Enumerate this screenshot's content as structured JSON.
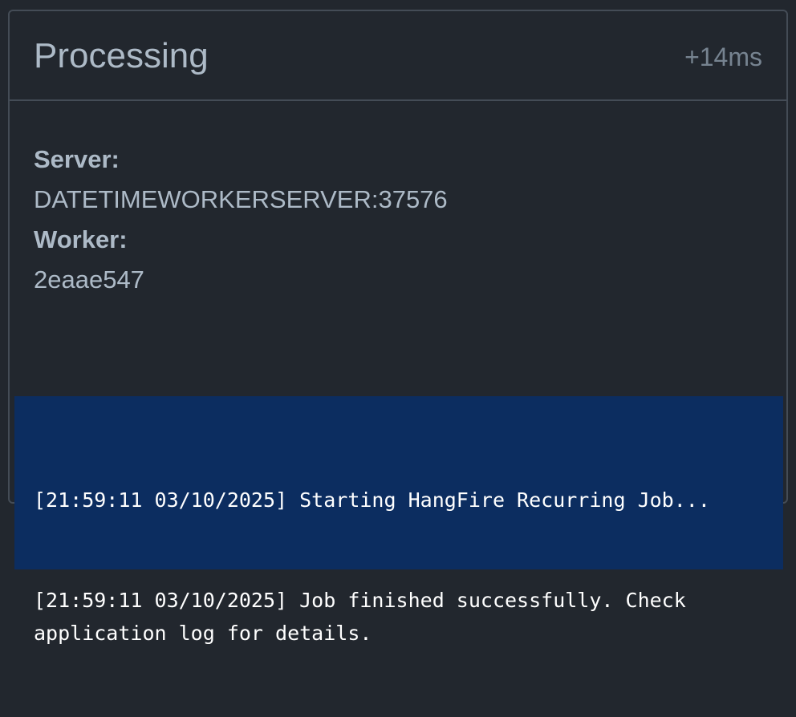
{
  "state": {
    "title": "Processing",
    "duration": "+14ms"
  },
  "details": {
    "server_label": "Server:",
    "server_value": "DATETIMEWORKERSERVER:37576",
    "worker_label": "Worker:",
    "worker_value": "2eaae547"
  },
  "log": {
    "lines": [
      "[21:59:11 03/10/2025] Starting HangFire Recurring Job...",
      "[21:59:11 03/10/2025] Job finished successfully. Check application log for details."
    ]
  },
  "colors": {
    "background": "#22272e",
    "border": "#444c56",
    "text": "#adbac7",
    "muted": "#768390",
    "log_background": "#0c2d60",
    "log_text": "#ffffff"
  }
}
